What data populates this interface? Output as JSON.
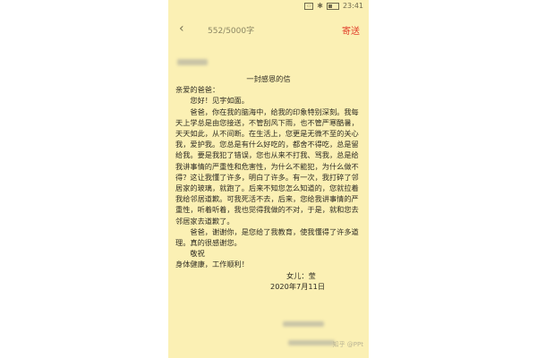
{
  "status_bar": {
    "time": "23:41",
    "icons": [
      "sim-icon",
      "bluetooth-icon",
      "battery-icon"
    ]
  },
  "toolbar": {
    "back_icon": "chevron-left-icon",
    "back_glyph": "‹",
    "word_count": "552/5000字",
    "send_label": "寄送"
  },
  "letter": {
    "title": "一封感恩的信",
    "salutation": "亲爱的爸爸：",
    "paragraphs": [
      "您好！见字如面。",
      "爸爸，你在我的脑海中，给我的印象特别深刻。我每天上学总是由您接送，不管刮风下雨，也不管严寒酷暑，天天如此，从不间断。在生活上，您更是无微不至的关心我，爱护我。您总是有什么好吃的，都舍不得吃，总是留给我。要是我犯了错误，您也从来不打我、骂我，总是给我讲事情的严重性和危害性，为什么不能犯，为什么做不得？这让我懂了许多，明白了许多。有一次，我打碎了邻居家的玻璃，就跑了。后来不知您怎么知道的，您就拉着我给邻居道歉。可我死活不去，后来，您给我讲事情的严重性，听着听着，我也觉得我做的不对，于是，就和您去邻居家去道歉了。",
      "爸爸，谢谢你，是您给了我教育，使我懂得了许多道理。真的很感谢您。"
    ],
    "closing": "敬祝",
    "wish": "身体健康，工作顺利！",
    "signature": "女儿：莹",
    "date": "2020年7月11日"
  },
  "watermark": "知乎 @PPt"
}
